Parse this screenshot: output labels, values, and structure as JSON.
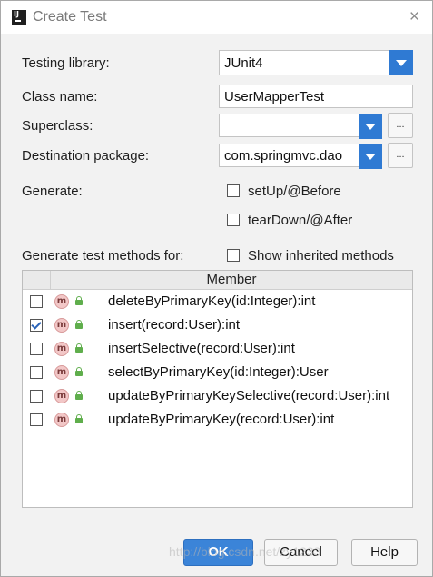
{
  "window": {
    "title": "Create Test",
    "icon": "intellij-icon",
    "icon_text": "IJ",
    "close_glyph": "×"
  },
  "form": {
    "testing_library": {
      "label": "Testing library:",
      "value": "JUnit4"
    },
    "class_name": {
      "label": "Class name:",
      "value": "UserMapperTest"
    },
    "superclass": {
      "label": "Superclass:",
      "value": ""
    },
    "destination_package": {
      "label": "Destination package:",
      "value": "com.springmvc.dao"
    },
    "browse_label": "...",
    "generate": {
      "label": "Generate:",
      "options": [
        {
          "label": "setUp/@Before",
          "checked": false
        },
        {
          "label": "tearDown/@After",
          "checked": false
        }
      ]
    },
    "methods_label": "Generate test methods for:",
    "show_inherited": {
      "label": "Show inherited methods",
      "checked": false
    }
  },
  "table": {
    "column_header": "Member",
    "row_icon_letter": "m",
    "rows": [
      {
        "name": "deleteByPrimaryKey(id:Integer):int",
        "checked": false
      },
      {
        "name": "insert(record:User):int",
        "checked": true
      },
      {
        "name": "insertSelective(record:User):int",
        "checked": false
      },
      {
        "name": "selectByPrimaryKey(id:Integer):User",
        "checked": false
      },
      {
        "name": "updateByPrimaryKeySelective(record:User):int",
        "checked": false
      },
      {
        "name": "updateByPrimaryKey(record:User):int",
        "checked": false
      }
    ]
  },
  "buttons": {
    "ok": "OK",
    "cancel": "Cancel",
    "help": "Help"
  },
  "watermark": "http://blog.csdn.net/zy1233",
  "colors": {
    "accent": "#3b84d8",
    "dropdown_arrow": "#2f7ad3",
    "method_icon": "#f2c7c7",
    "lock_icon": "#5fae4c"
  }
}
